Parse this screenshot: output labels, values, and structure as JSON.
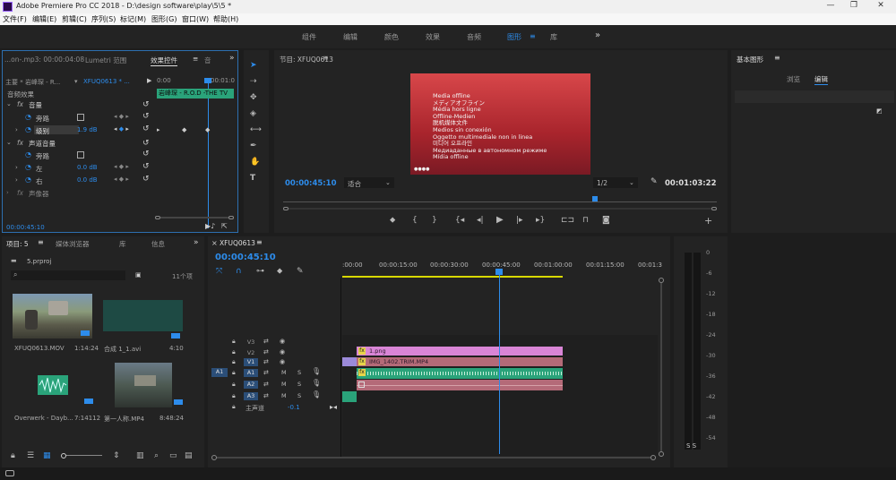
{
  "window": {
    "title": "Adobe Premiere Pro CC 2018 - D:\\design software\\play\\5\\5 *",
    "minimize": "—",
    "maximize": "❐",
    "close": "✕"
  },
  "menu": [
    "文件(F)",
    "编辑(E)",
    "剪辑(C)",
    "序列(S)",
    "标记(M)",
    "图形(G)",
    "窗口(W)",
    "帮助(H)"
  ],
  "workspaces": {
    "items": [
      "组件",
      "编辑",
      "颜色",
      "效果",
      "音频",
      "图形",
      "库"
    ],
    "active": "图形",
    "more": "»"
  },
  "effect_controls": {
    "tabs": [
      "...on-.mp3: 00:00:04:08",
      "Lumetri 范围",
      "效果控件",
      "音"
    ],
    "active_tab": "效果控件",
    "source_label": "主要 * 岩峰琛 - R...",
    "sequence_label": "XFUQ0613 * ...",
    "timecode_start": "0:00",
    "timecode_end": "00:01:0",
    "clip_label": "岩峰琛 - R.O.D -THE TV",
    "section": "音频效果",
    "rows": [
      {
        "fx": "fx",
        "name": "音量",
        "value": ""
      },
      {
        "fx": "",
        "name": "旁路",
        "value": ""
      },
      {
        "fx": "",
        "name": "级别",
        "value": "1.9 dB"
      },
      {
        "fx": "fx",
        "name": "声道音量",
        "value": ""
      },
      {
        "fx": "",
        "name": "旁路",
        "value": ""
      },
      {
        "fx": "",
        "name": "左",
        "value": "0.0 dB"
      },
      {
        "fx": "",
        "name": "右",
        "value": "0.0 dB"
      },
      {
        "fx": "fx",
        "name": "声像器",
        "value": ""
      }
    ],
    "footer_time": "00:00:45:10"
  },
  "program": {
    "title": "节目: XFUQ0613",
    "offline_lines": [
      "Media offline",
      "メディアオフライン",
      "Média hors ligne",
      "Offline-Medien",
      "脱机媒体文件",
      "Medios sin conexión",
      "Oggetto multimediale non in linea",
      "미디어 오프라인",
      "Медиаданные в автономном режиме",
      "Mídia offline"
    ],
    "current_time": "00:00:45:10",
    "fit": "适合",
    "resolution": "1/2",
    "duration": "00:01:03:22"
  },
  "essential_graphics": {
    "title": "基本图形",
    "tabs": [
      "浏览",
      "编辑"
    ],
    "active_tab": "编辑"
  },
  "project": {
    "tabs": [
      "项目: 5",
      "媒体浏览器",
      "库",
      "信息"
    ],
    "active_tab": "项目: 5",
    "file": "5.prproj",
    "item_count": "11个项",
    "items": [
      {
        "name": "XFUQ0613.MOV",
        "duration": "1:14:24"
      },
      {
        "name": "合成 1_1.avi",
        "duration": "4:10"
      },
      {
        "name": "Overwerk - Dayb...",
        "duration": "7:14112"
      },
      {
        "name": "第一人称.MP4",
        "duration": "8:48:24"
      }
    ]
  },
  "timeline": {
    "title": "XFUQ0613",
    "current_time": "00:00:45:10",
    "ruler": [
      ":00:00",
      "00:00:15:00",
      "00:00:30:00",
      "00:00:45:00",
      "00:01:00:00",
      "00:01:15:00",
      "00:01:3"
    ],
    "tracks": [
      {
        "label": "V3",
        "src": ""
      },
      {
        "label": "V2",
        "src": ""
      },
      {
        "label": "V1",
        "src": ""
      },
      {
        "label": "A1",
        "src": "A1"
      },
      {
        "label": "A2",
        "src": ""
      },
      {
        "label": "A3",
        "src": ""
      }
    ],
    "master": {
      "label": "主声道",
      "value": "-0.1"
    },
    "clips": {
      "v2": "1.png",
      "v1": "IMG_1402.TRIM.MP4"
    },
    "track_letters": [
      "M",
      "S"
    ]
  },
  "meter": {
    "scale": [
      "0",
      "-6",
      "-12",
      "-18",
      "-24",
      "-30",
      "-36",
      "-42",
      "-48",
      "-54"
    ],
    "footer": "S S"
  },
  "colors": {
    "accent_blue": "#2d8ceb",
    "offline_red": "#b0303a",
    "clip_pink": "#d985d6",
    "clip_green": "#2aa37a"
  }
}
